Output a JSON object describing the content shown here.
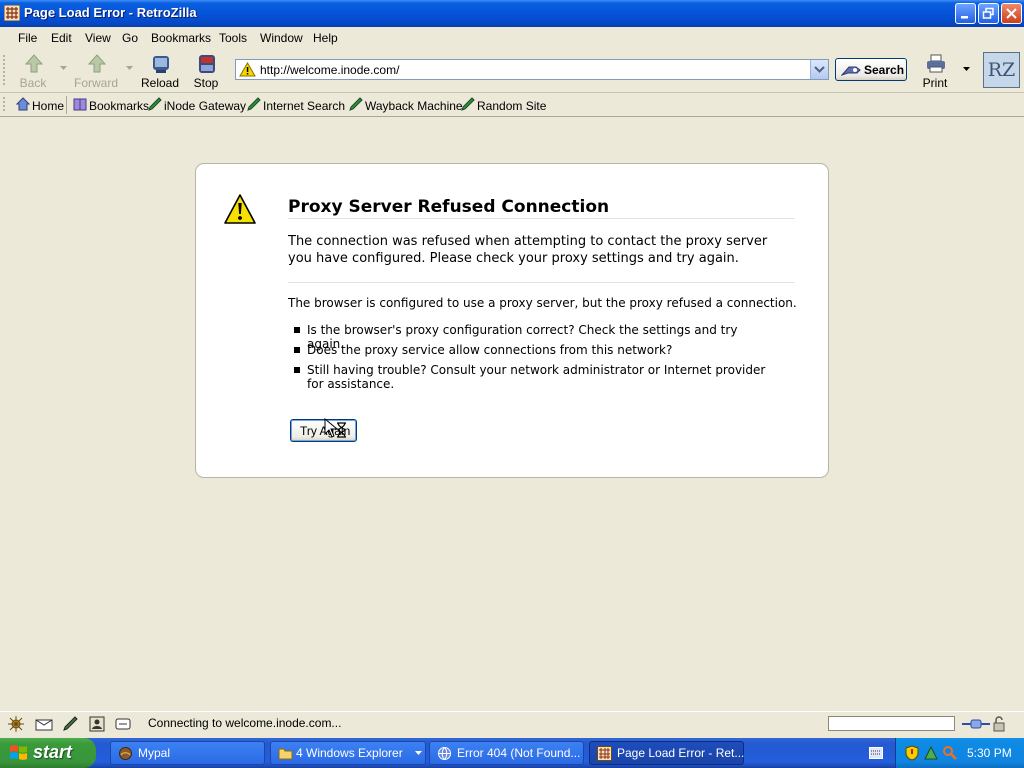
{
  "window": {
    "title": "Page Load Error - RetroZilla"
  },
  "menubar": {
    "items": [
      "File",
      "Edit",
      "View",
      "Go",
      "Bookmarks",
      "Tools",
      "Window",
      "Help"
    ]
  },
  "toolbar": {
    "back_label": "Back",
    "forward_label": "Forward",
    "reload_label": "Reload",
    "stop_label": "Stop",
    "print_label": "Print",
    "search_label": "Search",
    "url": "http://welcome.inode.com/",
    "logo_text": "RZ"
  },
  "bookmarks_bar": {
    "items": [
      "Home",
      "Bookmarks",
      "iNode Gateway",
      "Internet Search",
      "Wayback Machine",
      "Random Site"
    ]
  },
  "error_page": {
    "title": "Proxy Server Refused Connection",
    "description": "The connection was refused when attempting to contact the proxy server you have configured. Please check your proxy settings and try again.",
    "long_desc": "The browser is configured to use a proxy server, but the proxy refused a connection.",
    "bullets": [
      "Is the browser's proxy configuration correct? Check the settings and try again.",
      "Does the proxy service allow connections from this network?",
      "Still having trouble? Consult your network administrator or Internet provider for assistance."
    ],
    "try_again_label": "Try Again"
  },
  "statusbar": {
    "text": "Connecting to welcome.inode.com..."
  },
  "taskbar": {
    "start_label": "start",
    "tasks": [
      "Mypal",
      "4 Windows Explorer",
      "Error 404 (Not Found...",
      "Page Load Error - Ret..."
    ],
    "clock": "5:30 PM"
  },
  "colors": {
    "titlebar_blue": "#0553d6",
    "taskbar_blue": "#245edc",
    "start_green": "#3a9a3a",
    "warning_yellow": "#f5d600"
  }
}
